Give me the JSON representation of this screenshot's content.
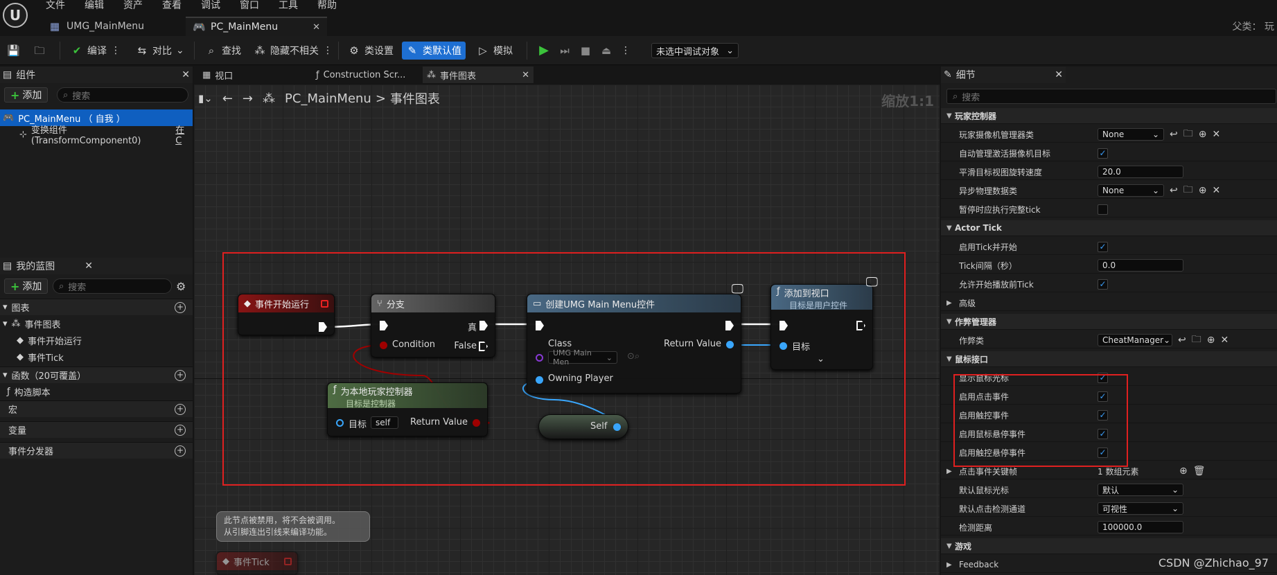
{
  "menu": [
    "文件",
    "编辑",
    "资产",
    "查看",
    "调试",
    "窗口",
    "工具",
    "帮助"
  ],
  "tabs": {
    "umg": "UMG_MainMenu",
    "pc": "PC_MainMenu"
  },
  "parent_label": "父类： 玩",
  "toolbar": {
    "compile": "编译",
    "diff": "对比",
    "find": "查找",
    "hide_unrelated": "隐藏不相关",
    "class_settings": "类设置",
    "class_defaults": "类默认值",
    "simulate": "模拟",
    "debug_select": "未选中调试对象"
  },
  "components": {
    "title": "组件",
    "add": "添加",
    "search_placeholder": "搜索",
    "root": "PC_MainMenu （ 自我 ）",
    "transform": "变换组件 (TransformComponent0)",
    "transform_suffix": "在C"
  },
  "blueprint": {
    "title": "我的蓝图",
    "add": "添加",
    "search_placeholder": "搜索",
    "graphs": "图表",
    "event_graph": "事件图表",
    "begin_play": "事件开始运行",
    "tick": "事件Tick",
    "functions": "函数（20可覆盖）",
    "construction": "构造脚本",
    "macros": "宏",
    "variables": "变量",
    "dispatchers": "事件分发器"
  },
  "center_tabs": [
    "视口",
    "Construction Scr...",
    "事件图表"
  ],
  "graph": {
    "breadcrumb_root": "PC_MainMenu",
    "breadcrumb_sep": ">",
    "breadcrumb_leaf": "事件图表",
    "zoom": "缩放1:1",
    "nodes": {
      "begin_play": {
        "title": "事件开始运行"
      },
      "branch": {
        "title": "分支",
        "true": "真",
        "false": "False",
        "condition": "Condition"
      },
      "create_widget": {
        "title": "创建UMG Main Menu控件",
        "class": "Class",
        "class_value": "UMG Main Men",
        "owning": "Owning Player",
        "return": "Return Value"
      },
      "add_viewport": {
        "title": "添加到视口",
        "subtitle": "目标是用户控件",
        "target": "目标"
      },
      "get_pc": {
        "title": "为本地玩家控制器",
        "subtitle": "目标是控制器",
        "target": "目标",
        "target_value": "self",
        "return": "Return Value"
      },
      "self": {
        "title": "Self"
      },
      "tick_disabled": {
        "title": "事件Tick"
      },
      "comment": {
        "line1": "此节点被禁用，将不会被调用。",
        "line2": "从引脚连出引线来编译功能。"
      }
    }
  },
  "details": {
    "title": "细节",
    "search_placeholder": "搜索",
    "rows": [
      {
        "type": "cat",
        "label": "玩家控制器"
      },
      {
        "type": "select",
        "label": "玩家摄像机管理器类",
        "value": "None",
        "icons": true
      },
      {
        "type": "check",
        "label": "自动管理激活摄像机目标",
        "checked": true
      },
      {
        "type": "input",
        "label": "平滑目标视图旋转速度",
        "value": "20.0"
      },
      {
        "type": "select",
        "label": "异步物理数据类",
        "value": "None",
        "icons": true
      },
      {
        "type": "check",
        "label": "暂停时应执行完整tick",
        "checked": false
      },
      {
        "type": "cat",
        "label": "Actor Tick"
      },
      {
        "type": "check",
        "label": "启用Tick并开始",
        "checked": true
      },
      {
        "type": "input",
        "label": "Tick间隔（秒）",
        "value": "0.0"
      },
      {
        "type": "check",
        "label": "允许开始播放前Tick",
        "checked": true
      },
      {
        "type": "sub",
        "label": "高级"
      },
      {
        "type": "cat",
        "label": "作弊管理器"
      },
      {
        "type": "select",
        "label": "作弊类",
        "value": "CheatManager",
        "icons": true
      },
      {
        "type": "cat",
        "label": "鼠标接口"
      },
      {
        "type": "check",
        "label": "显示鼠标光标",
        "checked": true
      },
      {
        "type": "check",
        "label": "启用点击事件",
        "checked": true
      },
      {
        "type": "check",
        "label": "启用触控事件",
        "checked": true
      },
      {
        "type": "check",
        "label": "启用鼠标悬停事件",
        "checked": true
      },
      {
        "type": "check",
        "label": "启用触控悬停事件",
        "checked": true
      },
      {
        "type": "array",
        "label": "点击事件关键帧",
        "value": "1 数组元素"
      },
      {
        "type": "select",
        "label": "默认鼠标光标",
        "value": "默认"
      },
      {
        "type": "select",
        "label": "默认点击检测通道",
        "value": "可视性"
      },
      {
        "type": "input",
        "label": "检测距离",
        "value": "100000.0"
      },
      {
        "type": "cat",
        "label": "游戏"
      },
      {
        "type": "sub",
        "label": "Feedback"
      }
    ]
  },
  "watermark": "CSDN @Zhichao_97",
  "colors": {
    "accent": "#1e6fd2",
    "selection": "#e02020",
    "exec": "#ffffff",
    "object_pin": "#3aa8ff",
    "bool_pin": "#a00000",
    "event_head": "#8a1414",
    "branch_head": "#5a5a5a",
    "func_head": "#3b5a73",
    "pure_head": "#3f5c35"
  }
}
